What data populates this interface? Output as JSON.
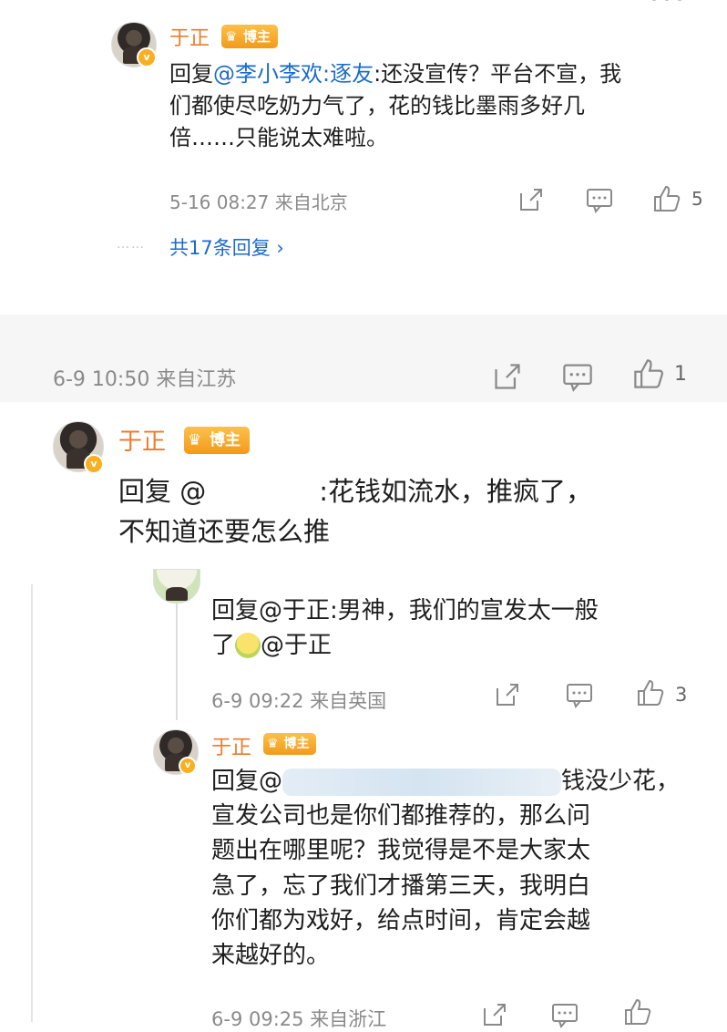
{
  "comment1": {
    "author": "于正",
    "badge": "博主",
    "reply_prefix": "回复",
    "mention": "@李小李欢:逐友",
    "line1_rest": ":还没宣传？平台不宣，我",
    "line2": "们都使尽吃奶力气了，花的钱比墨雨多好几",
    "line3": "倍……只能说太难啦。",
    "meta": "5-16 08:27 来自北京",
    "likes": "5",
    "more_replies": "共17条回复 ›"
  },
  "section2": {
    "meta": "6-9 10:50 来自江苏",
    "likes": "1"
  },
  "comment2": {
    "author": "于正",
    "badge": "博主",
    "reply_prefix": "回复 @",
    "line1_rest": ":花钱如流水，推疯了，",
    "line2": "不知道还要怎么推"
  },
  "reply1": {
    "line1": "回复@于正:男神，我们的宣发太一般",
    "line2_prefix": "了",
    "line2_mention": "@于正",
    "meta": "6-9 09:22 来自英国",
    "likes": "3"
  },
  "reply2": {
    "author": "于正",
    "badge": "博主",
    "line1_prefix": "回复@",
    "line1_rest": "钱没少花，",
    "line2": "宣发公司也是你们都推荐的，那么问",
    "line3": "题出在哪里呢？我觉得是不是大家太",
    "line4": "急了，忘了我们才播第三天，我明白",
    "line5": "你们都为戏好，给点时间，肯定会越",
    "line6": "来越好的。",
    "meta": "6-9 09:25 来自浙江"
  },
  "icons": {
    "share": "share-icon",
    "comment": "comment-icon",
    "like": "like-icon",
    "more": "more-icon"
  },
  "colors": {
    "name": "#eb7b2b",
    "mention": "#1b6bc9",
    "meta": "#8a8a8a",
    "badge": "#f7a52a"
  }
}
